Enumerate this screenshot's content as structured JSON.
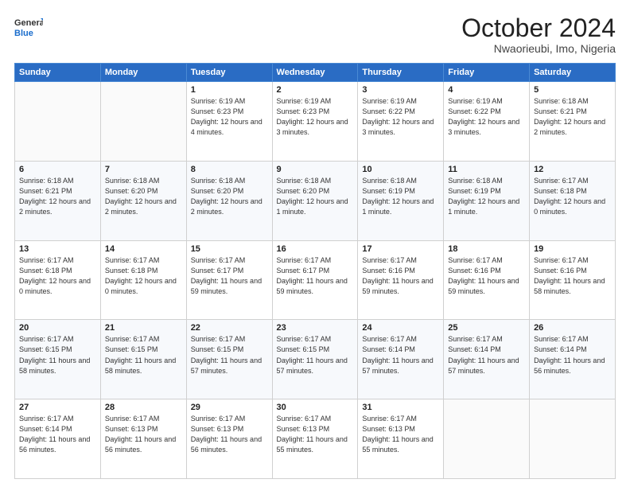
{
  "header": {
    "logo_general": "General",
    "logo_blue": "Blue",
    "month_title": "October 2024",
    "location": "Nwaorieubi, Imo, Nigeria"
  },
  "days_of_week": [
    "Sunday",
    "Monday",
    "Tuesday",
    "Wednesday",
    "Thursday",
    "Friday",
    "Saturday"
  ],
  "weeks": [
    [
      {
        "day": "",
        "info": ""
      },
      {
        "day": "",
        "info": ""
      },
      {
        "day": "1",
        "info": "Sunrise: 6:19 AM\nSunset: 6:23 PM\nDaylight: 12 hours and 4 minutes."
      },
      {
        "day": "2",
        "info": "Sunrise: 6:19 AM\nSunset: 6:23 PM\nDaylight: 12 hours and 3 minutes."
      },
      {
        "day": "3",
        "info": "Sunrise: 6:19 AM\nSunset: 6:22 PM\nDaylight: 12 hours and 3 minutes."
      },
      {
        "day": "4",
        "info": "Sunrise: 6:19 AM\nSunset: 6:22 PM\nDaylight: 12 hours and 3 minutes."
      },
      {
        "day": "5",
        "info": "Sunrise: 6:18 AM\nSunset: 6:21 PM\nDaylight: 12 hours and 2 minutes."
      }
    ],
    [
      {
        "day": "6",
        "info": "Sunrise: 6:18 AM\nSunset: 6:21 PM\nDaylight: 12 hours and 2 minutes."
      },
      {
        "day": "7",
        "info": "Sunrise: 6:18 AM\nSunset: 6:20 PM\nDaylight: 12 hours and 2 minutes."
      },
      {
        "day": "8",
        "info": "Sunrise: 6:18 AM\nSunset: 6:20 PM\nDaylight: 12 hours and 2 minutes."
      },
      {
        "day": "9",
        "info": "Sunrise: 6:18 AM\nSunset: 6:20 PM\nDaylight: 12 hours and 1 minute."
      },
      {
        "day": "10",
        "info": "Sunrise: 6:18 AM\nSunset: 6:19 PM\nDaylight: 12 hours and 1 minute."
      },
      {
        "day": "11",
        "info": "Sunrise: 6:18 AM\nSunset: 6:19 PM\nDaylight: 12 hours and 1 minute."
      },
      {
        "day": "12",
        "info": "Sunrise: 6:17 AM\nSunset: 6:18 PM\nDaylight: 12 hours and 0 minutes."
      }
    ],
    [
      {
        "day": "13",
        "info": "Sunrise: 6:17 AM\nSunset: 6:18 PM\nDaylight: 12 hours and 0 minutes."
      },
      {
        "day": "14",
        "info": "Sunrise: 6:17 AM\nSunset: 6:18 PM\nDaylight: 12 hours and 0 minutes."
      },
      {
        "day": "15",
        "info": "Sunrise: 6:17 AM\nSunset: 6:17 PM\nDaylight: 11 hours and 59 minutes."
      },
      {
        "day": "16",
        "info": "Sunrise: 6:17 AM\nSunset: 6:17 PM\nDaylight: 11 hours and 59 minutes."
      },
      {
        "day": "17",
        "info": "Sunrise: 6:17 AM\nSunset: 6:16 PM\nDaylight: 11 hours and 59 minutes."
      },
      {
        "day": "18",
        "info": "Sunrise: 6:17 AM\nSunset: 6:16 PM\nDaylight: 11 hours and 59 minutes."
      },
      {
        "day": "19",
        "info": "Sunrise: 6:17 AM\nSunset: 6:16 PM\nDaylight: 11 hours and 58 minutes."
      }
    ],
    [
      {
        "day": "20",
        "info": "Sunrise: 6:17 AM\nSunset: 6:15 PM\nDaylight: 11 hours and 58 minutes."
      },
      {
        "day": "21",
        "info": "Sunrise: 6:17 AM\nSunset: 6:15 PM\nDaylight: 11 hours and 58 minutes."
      },
      {
        "day": "22",
        "info": "Sunrise: 6:17 AM\nSunset: 6:15 PM\nDaylight: 11 hours and 57 minutes."
      },
      {
        "day": "23",
        "info": "Sunrise: 6:17 AM\nSunset: 6:15 PM\nDaylight: 11 hours and 57 minutes."
      },
      {
        "day": "24",
        "info": "Sunrise: 6:17 AM\nSunset: 6:14 PM\nDaylight: 11 hours and 57 minutes."
      },
      {
        "day": "25",
        "info": "Sunrise: 6:17 AM\nSunset: 6:14 PM\nDaylight: 11 hours and 57 minutes."
      },
      {
        "day": "26",
        "info": "Sunrise: 6:17 AM\nSunset: 6:14 PM\nDaylight: 11 hours and 56 minutes."
      }
    ],
    [
      {
        "day": "27",
        "info": "Sunrise: 6:17 AM\nSunset: 6:14 PM\nDaylight: 11 hours and 56 minutes."
      },
      {
        "day": "28",
        "info": "Sunrise: 6:17 AM\nSunset: 6:13 PM\nDaylight: 11 hours and 56 minutes."
      },
      {
        "day": "29",
        "info": "Sunrise: 6:17 AM\nSunset: 6:13 PM\nDaylight: 11 hours and 56 minutes."
      },
      {
        "day": "30",
        "info": "Sunrise: 6:17 AM\nSunset: 6:13 PM\nDaylight: 11 hours and 55 minutes."
      },
      {
        "day": "31",
        "info": "Sunrise: 6:17 AM\nSunset: 6:13 PM\nDaylight: 11 hours and 55 minutes."
      },
      {
        "day": "",
        "info": ""
      },
      {
        "day": "",
        "info": ""
      }
    ]
  ]
}
